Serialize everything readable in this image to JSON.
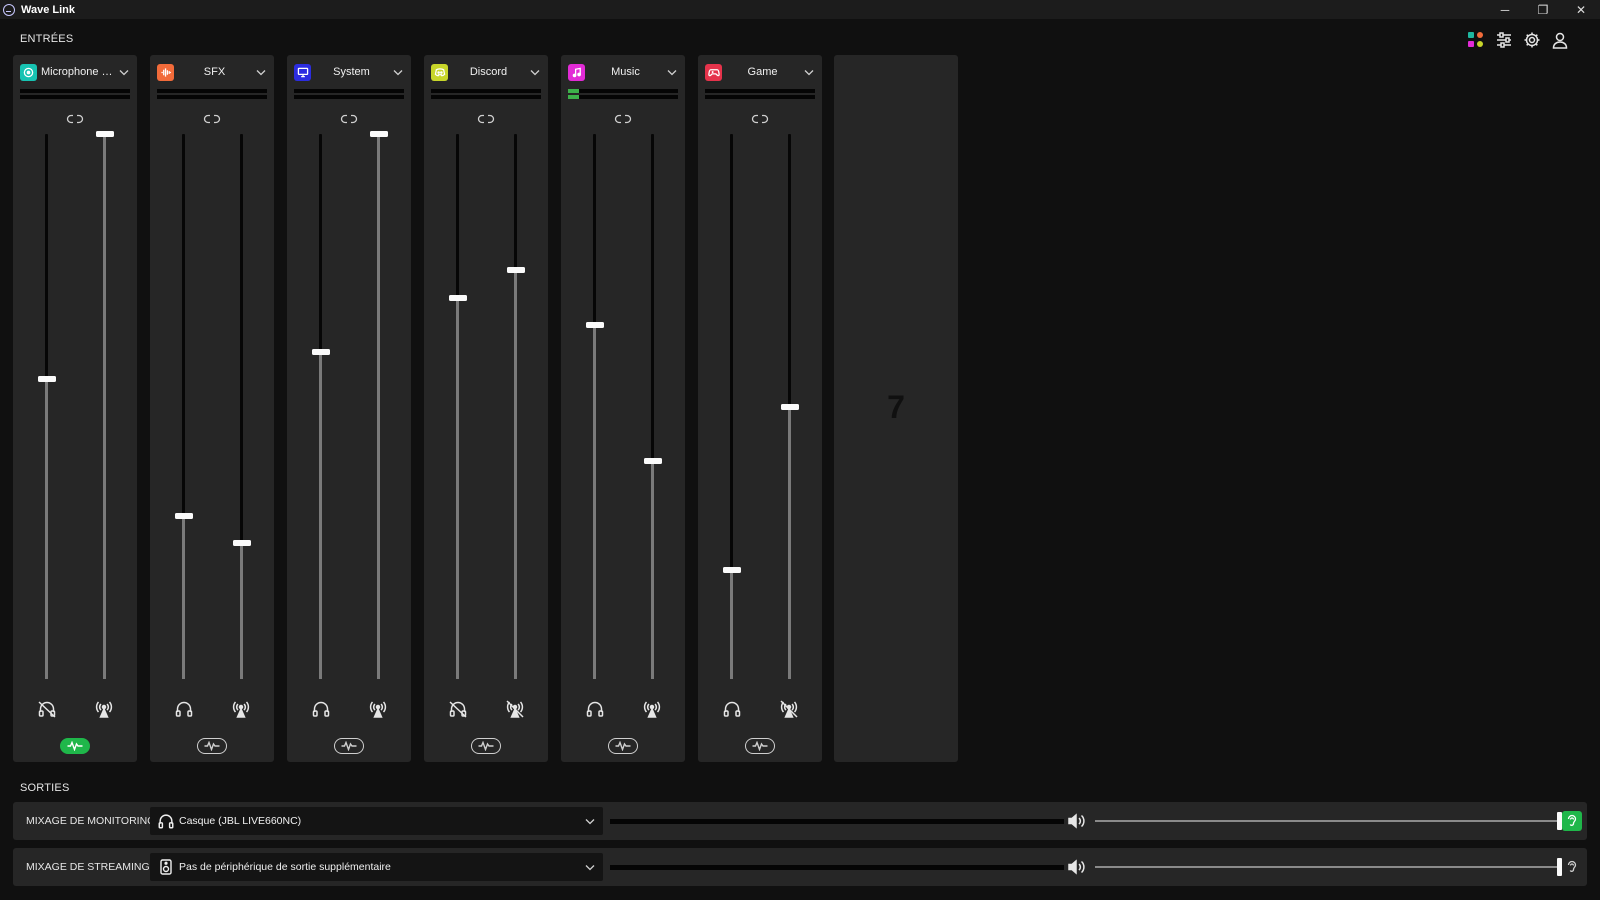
{
  "window": {
    "title": "Wave Link",
    "controls": {
      "minimize": "─",
      "restore": "❐",
      "close": "✕"
    }
  },
  "inputs": {
    "section_label": "ENTRÉES",
    "toolbar_icons": [
      "marketplace-icon",
      "mix-sliders-icon",
      "gear-icon",
      "user-icon"
    ],
    "channels": [
      {
        "name": "Microphone (Y...",
        "icon": "microphone-icon",
        "color": "#17c3b2",
        "meter_level": 0.0,
        "monitor_level": 0.55,
        "stream_level": 1.0,
        "monitor_muted": true,
        "stream_muted": false,
        "effects_on": true
      },
      {
        "name": "SFX",
        "icon": "waveform-icon",
        "color": "#f26b3a",
        "meter_level": 0.0,
        "monitor_level": 0.3,
        "stream_level": 0.25,
        "monitor_muted": false,
        "stream_muted": false,
        "effects_on": false
      },
      {
        "name": "System",
        "icon": "monitor-icon",
        "color": "#2c2de0",
        "meter_level": 0.0,
        "monitor_level": 0.6,
        "stream_level": 1.0,
        "monitor_muted": false,
        "stream_muted": false,
        "effects_on": false
      },
      {
        "name": "Discord",
        "icon": "discord-icon",
        "color": "#c8d62a",
        "meter_level": 0.0,
        "monitor_level": 0.7,
        "stream_level": 0.75,
        "monitor_muted": true,
        "stream_muted": true,
        "effects_on": false
      },
      {
        "name": "Music",
        "icon": "music-note-icon",
        "color": "#e22bd6",
        "meter_level": 0.1,
        "monitor_level": 0.65,
        "stream_level": 0.4,
        "monitor_muted": false,
        "stream_muted": false,
        "effects_on": false
      },
      {
        "name": "Game",
        "icon": "gamepad-icon",
        "color": "#e5334b",
        "meter_level": 0.0,
        "monitor_level": 0.2,
        "stream_level": 0.5,
        "monitor_muted": false,
        "stream_muted": true,
        "effects_on": false
      }
    ],
    "add_channel_label": "7"
  },
  "outputs": {
    "section_label": "SORTIES",
    "rows": [
      {
        "label": "MIXAGE DE MONITORING",
        "device_icon": "headphones-icon",
        "device": "Casque (JBL LIVE660NC)",
        "meter_level": 0.0,
        "volume_level": 1.0,
        "listen_active": true
      },
      {
        "label": "MIXAGE DE STREAMING",
        "device_icon": "speaker-icon",
        "device": "Pas de périphérique de sortie supplémentaire",
        "meter_level": 0.0,
        "volume_level": 1.0,
        "listen_active": false
      }
    ]
  },
  "colors": {
    "background": "#101010",
    "panel": "#262626",
    "accent_green": "#1fb74a"
  }
}
